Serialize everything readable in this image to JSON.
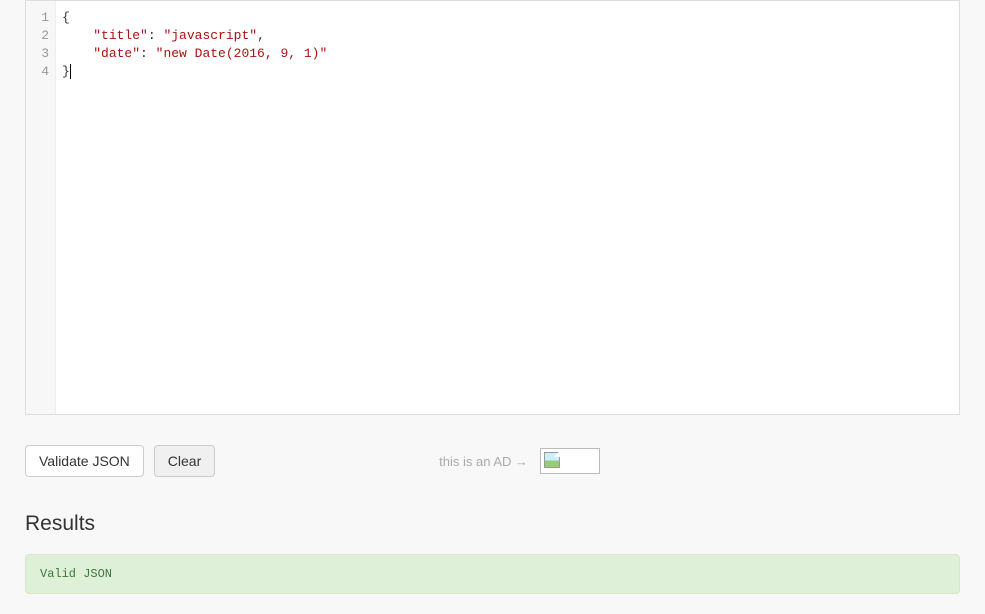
{
  "editor": {
    "lines": [
      {
        "num": "1",
        "tokens": [
          {
            "t": "brace",
            "v": "{"
          }
        ]
      },
      {
        "num": "2",
        "tokens": [
          {
            "t": "indent",
            "v": "    "
          },
          {
            "t": "str",
            "v": "\"title\""
          },
          {
            "t": "punc",
            "v": ": "
          },
          {
            "t": "str",
            "v": "\"javascript\""
          },
          {
            "t": "punc",
            "v": ","
          }
        ]
      },
      {
        "num": "3",
        "tokens": [
          {
            "t": "indent",
            "v": "    "
          },
          {
            "t": "str",
            "v": "\"date\""
          },
          {
            "t": "punc",
            "v": ": "
          },
          {
            "t": "str",
            "v": "\"new Date(2016, 9, 1)\""
          }
        ]
      },
      {
        "num": "4",
        "tokens": [
          {
            "t": "brace",
            "v": "}"
          },
          {
            "t": "cursor",
            "v": ""
          }
        ]
      }
    ]
  },
  "buttons": {
    "validate": "Validate JSON",
    "clear": "Clear"
  },
  "ad": {
    "label": "this is an AD →"
  },
  "results": {
    "heading": "Results",
    "message": "Valid JSON"
  }
}
